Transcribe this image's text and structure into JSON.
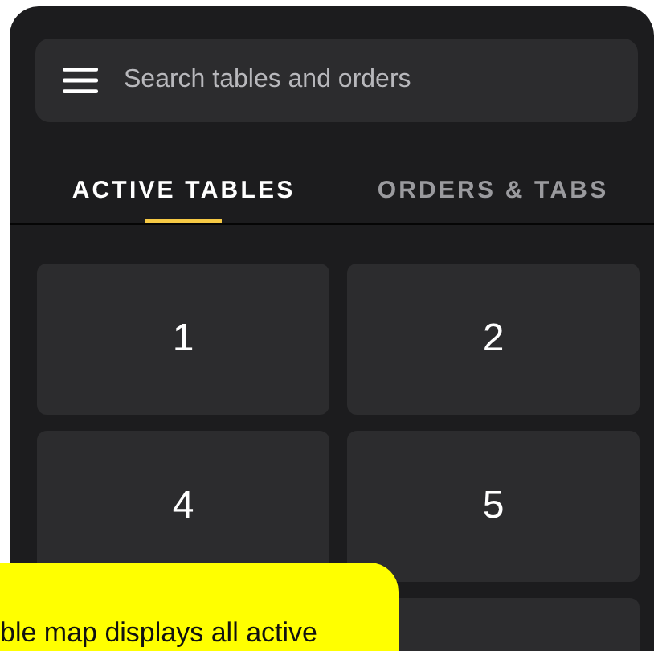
{
  "search": {
    "placeholder": "Search tables and orders"
  },
  "tabs": [
    {
      "label": "ACTIVE TABLES",
      "selected": true
    },
    {
      "label": "ORDERS & TABS",
      "selected": false
    }
  ],
  "tables": [
    {
      "label": "1"
    },
    {
      "label": "2"
    },
    {
      "label": "4"
    },
    {
      "label": "5"
    }
  ],
  "callout": {
    "text": "ble map displays all active"
  }
}
